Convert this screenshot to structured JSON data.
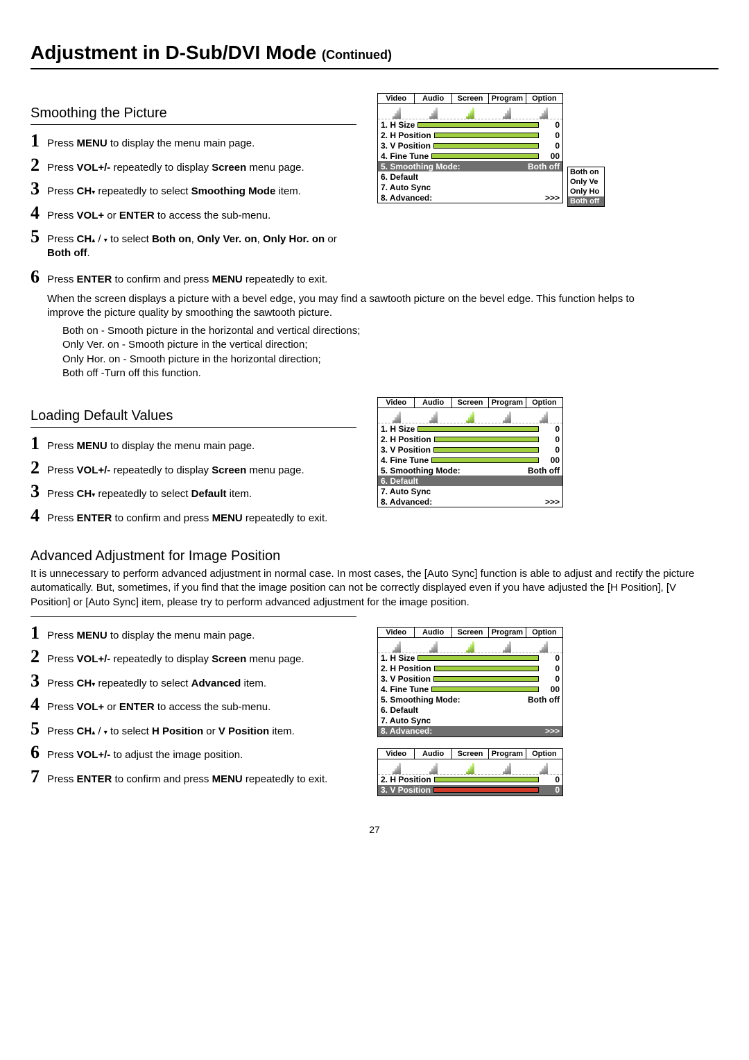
{
  "title_main": "Adjustment in D-Sub/DVI Mode ",
  "title_cont": "(Continued)",
  "page_number": "27",
  "osd_tabs": [
    "Video",
    "Audio",
    "Screen",
    "Program",
    "Option"
  ],
  "section1": {
    "title": "Smoothing the Picture",
    "steps": [
      {
        "n": "1",
        "parts": [
          "Press ",
          "b:MENU",
          " to display the menu main page."
        ]
      },
      {
        "n": "2",
        "parts": [
          "Press ",
          "b:VOL+/-",
          " repeatedly to display ",
          "b:Screen",
          " menu page."
        ]
      },
      {
        "n": "3",
        "parts": [
          "Press ",
          "b:CH",
          "tri",
          " repeatedly to select ",
          "b:Smoothing Mode",
          " item."
        ]
      },
      {
        "n": "4",
        "parts": [
          "Press ",
          "b:VOL+",
          " or ",
          "b:ENTER",
          " to access the sub-menu."
        ]
      },
      {
        "n": "5",
        "parts": [
          "Press ",
          "b:CH",
          "updn",
          " to select ",
          "b:Both on",
          ", ",
          "b:Only Ver. on",
          ", ",
          "b:Only Hor. on",
          " or ",
          "b:Both off",
          "."
        ]
      },
      {
        "n": "6",
        "parts": [
          "Press ",
          "b:ENTER",
          " to confirm and press ",
          "b:MENU",
          " repeatedly to exit."
        ]
      }
    ],
    "note1": "When the screen displays a picture with a bevel edge, you may find a sawtooth picture on the bevel edge. This function helps to improve the picture quality by smoothing the sawtooth picture.",
    "sub": [
      "Both on - Smooth picture in the horizontal and vertical directions;",
      "Only Ver. on - Smooth picture in the vertical direction;",
      "Only Hor. on - Smooth picture in the horizontal direction;",
      "Both off -Turn off this function."
    ],
    "osd_rows": [
      {
        "label": "1. H Size",
        "slider": true,
        "val": "0"
      },
      {
        "label": "2. H Position",
        "slider": true,
        "val": "0"
      },
      {
        "label": "3. V Position",
        "slider": true,
        "val": "0"
      },
      {
        "label": "4. Fine Tune",
        "slider": true,
        "val": "00"
      },
      {
        "label": "5. Smoothing Mode:",
        "hi": true,
        "val": "Both off"
      },
      {
        "label": "6. Default"
      },
      {
        "label": "7. Auto Sync"
      },
      {
        "label": "8. Advanced:",
        "val": ">>>"
      }
    ],
    "popup": [
      "Both on",
      "Only Ve",
      "Only Ho",
      "Both off"
    ],
    "popup_selected": 3
  },
  "section2": {
    "title": "Loading Default Values",
    "steps": [
      {
        "n": "1",
        "parts": [
          "Press ",
          "b:MENU",
          " to display the menu main page."
        ]
      },
      {
        "n": "2",
        "parts": [
          "Press ",
          "b:VOL+/-",
          " repeatedly to display ",
          "b:Screen",
          " menu page."
        ]
      },
      {
        "n": "3",
        "parts": [
          "Press ",
          "b:CH",
          "tri",
          " repeatedly to select ",
          "b:Default",
          " item."
        ]
      },
      {
        "n": "4",
        "parts": [
          "Press ",
          "b:ENTER",
          " to confirm and press ",
          "b:MENU",
          " repeatedly to exit."
        ]
      }
    ],
    "osd_rows": [
      {
        "label": "1. H Size",
        "slider": true,
        "val": "0"
      },
      {
        "label": "2. H Position",
        "slider": true,
        "val": "0"
      },
      {
        "label": "3. V Position",
        "slider": true,
        "val": "0"
      },
      {
        "label": "4. Fine Tune",
        "slider": true,
        "val": "00"
      },
      {
        "label": "5. Smoothing Mode:",
        "val": "Both off"
      },
      {
        "label": "6. Default",
        "hi": true
      },
      {
        "label": "7. Auto Sync"
      },
      {
        "label": "8. Advanced:",
        "val": ">>>"
      }
    ]
  },
  "section3": {
    "title": "Advanced Adjustment for Image Position",
    "intro": "It is unnecessary to perform advanced adjustment in normal case. In most cases, the [Auto Sync] function is able to adjust and rectify the picture automatically. But, sometimes, if you find that the image position can not be correctly displayed even if you have adjusted the [H Position], [V Position] or [Auto Sync] item, please try to perform advanced adjustment for the image position.",
    "steps": [
      {
        "n": "1",
        "parts": [
          "Press ",
          "b:MENU",
          " to display the menu main page."
        ]
      },
      {
        "n": "2",
        "parts": [
          "Press ",
          "b:VOL+/-",
          " repeatedly to display ",
          "b:Screen",
          " menu page."
        ]
      },
      {
        "n": "3",
        "parts": [
          "Press ",
          "b:CH",
          "tri2",
          " repeatedly to select ",
          "b:Advanced",
          " item."
        ]
      },
      {
        "n": "4",
        "parts": [
          "Press ",
          "b:VOL+",
          " or ",
          "b:ENTER",
          " to access the sub-menu."
        ]
      },
      {
        "n": "5",
        "parts": [
          "Press ",
          "b:CH",
          "updn",
          " to select ",
          "b:H Position",
          " or ",
          "b:V Position",
          " item."
        ]
      },
      {
        "n": "6",
        "parts": [
          "Press ",
          "b:VOL+/-",
          " to adjust the image position."
        ]
      },
      {
        "n": "7",
        "parts": [
          "Press ",
          "b:ENTER",
          " to confirm and press ",
          "b:MENU",
          " repeatedly to exit."
        ]
      }
    ],
    "osd1_rows": [
      {
        "label": "1. H Size",
        "slider": true,
        "val": "0"
      },
      {
        "label": "2. H Position",
        "slider": true,
        "val": "0"
      },
      {
        "label": "3. V Position",
        "slider": true,
        "val": "0"
      },
      {
        "label": "4. Fine Tune",
        "slider": true,
        "val": "00"
      },
      {
        "label": "5. Smoothing Mode:",
        "val": "Both off"
      },
      {
        "label": "6. Default"
      },
      {
        "label": "7. Auto Sync"
      },
      {
        "label": "8. Advanced:",
        "hi": true,
        "val": ">>>"
      }
    ],
    "osd2_rows": [
      {
        "label": "2. H Position",
        "slider": true,
        "val": "0"
      },
      {
        "label": "3. V Position",
        "hi": true,
        "slider": "red",
        "val": "0"
      }
    ]
  }
}
